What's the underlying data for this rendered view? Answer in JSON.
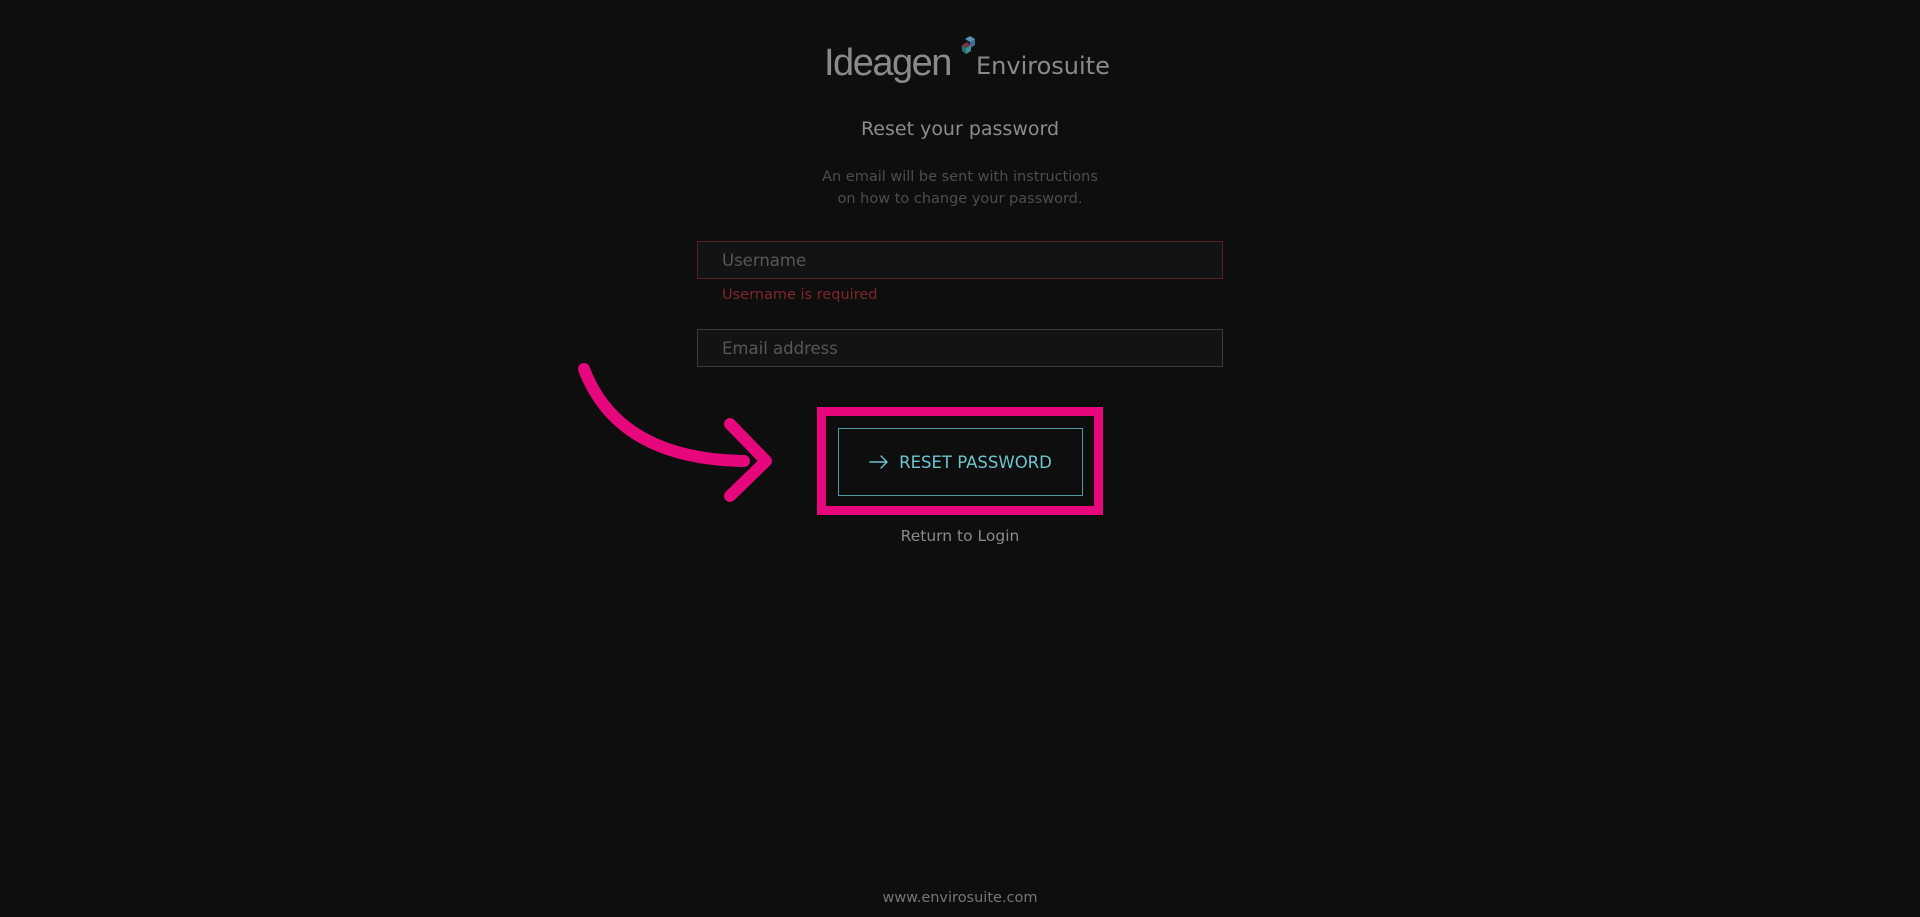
{
  "brand": {
    "primary": "Ideagen",
    "secondary": "Envirosuite"
  },
  "form": {
    "heading": "Reset your password",
    "description_line1": "An email will be sent with instructions",
    "description_line2": "on how to change your password.",
    "username_placeholder": "Username",
    "username_value": "",
    "username_error": "Username is required",
    "email_placeholder": "Email address",
    "email_value": "",
    "submit_label": "RESET PASSWORD",
    "return_label": "Return to Login"
  },
  "footer": {
    "website": "www.envirosuite.com"
  },
  "colors": {
    "background": "#0e0e0f",
    "accent": "#6fc4cd",
    "error": "#7f262c",
    "annotation": "#e5077b"
  },
  "icons": {
    "submit": "arrow-right-icon",
    "annotation": "curved-arrow-icon"
  }
}
